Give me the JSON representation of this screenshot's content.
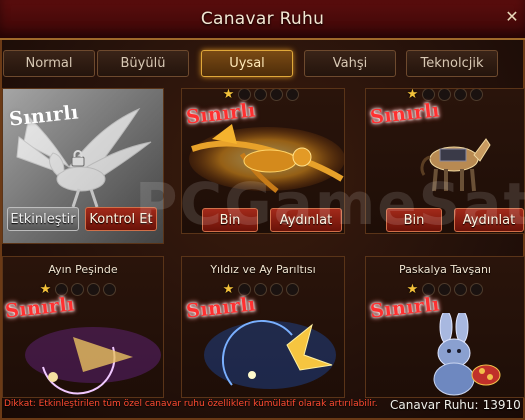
{
  "window": {
    "title": "Canavar Ruhu"
  },
  "tabs": [
    {
      "label": "Normal",
      "active": false
    },
    {
      "label": "Büyülü",
      "active": false
    },
    {
      "label": "Uysal",
      "active": true
    },
    {
      "label": "Vahşi",
      "active": false
    },
    {
      "label": "Teknolcjik",
      "active": false
    }
  ],
  "cards": [
    {
      "id": "c1",
      "name": "",
      "stars_filled": 0,
      "stars_total": 0,
      "badge": "Sınırlı",
      "locked": true,
      "art": "white-winged-pegasus",
      "buttons": [
        "Etkinleştir",
        "Kontrol Et"
      ]
    },
    {
      "id": "c2",
      "name": "",
      "stars_filled": 1,
      "stars_total": 5,
      "badge": "Sınırlı",
      "locked": false,
      "art": "golden-fire-drake",
      "buttons": [
        "Bin",
        "Aydınlat"
      ]
    },
    {
      "id": "c3",
      "name": "",
      "stars_filled": 1,
      "stars_total": 5,
      "badge": "Sınırlı",
      "locked": false,
      "art": "armored-horse",
      "buttons": [
        "Bin",
        "Aydınlat"
      ]
    },
    {
      "id": "c4",
      "name": "Ayın Peşinde",
      "stars_filled": 1,
      "stars_total": 5,
      "badge": "Sınırlı",
      "locked": false,
      "art": "purple-crescent-moon"
    },
    {
      "id": "c5",
      "name": "Yıldız ve Ay Parıltısı",
      "stars_filled": 1,
      "stars_total": 5,
      "badge": "Sınırlı",
      "locked": false,
      "art": "blue-gold-moon-star"
    },
    {
      "id": "c6",
      "name": "Paskalya Tavşanı",
      "stars_filled": 1,
      "stars_total": 5,
      "badge": "Sınırlı",
      "locked": false,
      "art": "easter-bunny"
    }
  ],
  "footer": {
    "note": "Dikkat: Etkinleştirilen tüm özel canavar ruhu özellikleri kümülatif olarak artırılabilir.",
    "spirit_label": "Canavar Ruhu:",
    "spirit_value": "13910"
  },
  "watermark": "PCGameSat.s"
}
